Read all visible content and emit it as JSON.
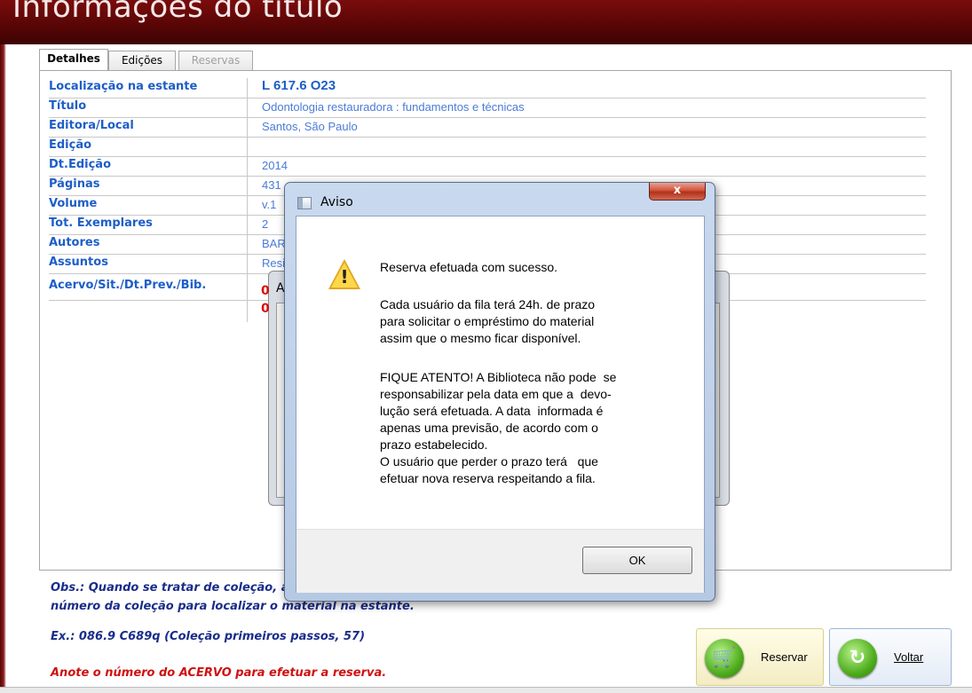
{
  "header": {
    "title": "Informações do título"
  },
  "tabs": [
    {
      "label": "Detalhes"
    },
    {
      "label": "Edições"
    },
    {
      "label": "Reservas"
    }
  ],
  "details": [
    {
      "label": "Localização na estante",
      "value": "L 617.6 O23"
    },
    {
      "label": "Título",
      "value": "Odontologia restauradora : fundamentos e técnicas"
    },
    {
      "label": "Editora/Local",
      "value": "Santos, São Paulo"
    },
    {
      "label": "Edição",
      "value": ""
    },
    {
      "label": "Dt.Edição",
      "value": "2014"
    },
    {
      "label": "Páginas",
      "value": "431"
    },
    {
      "label": "Volume",
      "value": "v.1"
    },
    {
      "label": "Tot. Exemplares",
      "value": "2"
    },
    {
      "label": "Autores",
      "value": "BAR"
    },
    {
      "label": "Assuntos",
      "value": "Resi"
    },
    {
      "label": "Acervo/Sit./Dt.Prev./Bib.",
      "value": ""
    }
  ],
  "background_dialog": {
    "title_fragment": "A",
    "acervo_values": [
      "0",
      "0"
    ]
  },
  "notes": {
    "obs_line1": "Obs.: Quando se tratar de coleção, a",
    "obs_line2": "número da coleção para localizar o material na estante.",
    "example": "Ex.: 086.9  C689q (Coleção primeiros passos, 57)",
    "reserve_hint": "Anote o número do ACERVO para efetuar a reserva."
  },
  "buttons": {
    "reserve": "Reservar",
    "back": "Voltar"
  },
  "dialog": {
    "title": "Aviso",
    "close": "x",
    "paragraphs": [
      "Reserva efetuada com sucesso.",
      "Cada usuário da fila terá 24h. de prazo\npara solicitar o empréstimo do material\nassim que o mesmo ficar disponível.",
      "FIQUE ATENTO! A Biblioteca não pode  se\nresponsabilizar pela data em que a  devo-\nlução será efetuada. A data  informada é\napenas uma previsão, de acordo com o\nprazo estabelecido.\nO usuário que perder o prazo terá   que\nefetuar nova reserva respeitando a fila."
    ],
    "ok": "OK"
  }
}
